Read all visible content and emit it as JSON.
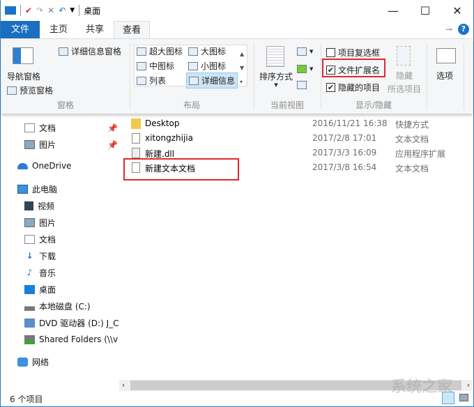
{
  "window": {
    "title": "桌面",
    "minimize": "—",
    "maximize": "☐",
    "close": "✕",
    "help": "?"
  },
  "tabs": [
    {
      "label": "文件"
    },
    {
      "label": "主页"
    },
    {
      "label": "共享"
    },
    {
      "label": "查看"
    }
  ],
  "ribbon": {
    "panes": {
      "nav_pane": "导航窗格",
      "preview_pane": "预览窗格",
      "details_pane": "详细信息窗格",
      "group": "窗格"
    },
    "layout": {
      "items": [
        "超大图标",
        "大图标",
        "中图标",
        "小图标",
        "列表",
        "详细信息"
      ],
      "selected": "详细信息",
      "group": "布局"
    },
    "current_view": {
      "sort_by": "排序方式",
      "group": "当前视图"
    },
    "show_hide": {
      "item_checkboxes": {
        "label": "项目复选框",
        "checked": false
      },
      "file_extensions": {
        "label": "文件扩展名",
        "checked": true
      },
      "hidden_items": {
        "label": "隐藏的项目",
        "checked": true
      },
      "hide_selected_1": "隐藏",
      "hide_selected_2": "所选项目",
      "group": "显示/隐藏"
    },
    "options": "选项"
  },
  "nav": [
    {
      "label": "文档",
      "pinned": true
    },
    {
      "label": "图片",
      "pinned": true
    },
    {
      "label": "OneDrive"
    },
    {
      "label": "此电脑"
    },
    {
      "label": "视频"
    },
    {
      "label": "图片"
    },
    {
      "label": "文档"
    },
    {
      "label": "下载"
    },
    {
      "label": "音乐"
    },
    {
      "label": "桌面"
    },
    {
      "label": "本地磁盘 (C:)"
    },
    {
      "label": "DVD 驱动器 (D:) J_C"
    },
    {
      "label": "Shared Folders (\\\\v"
    },
    {
      "label": "网络"
    }
  ],
  "files": [
    {
      "name": "Desktop",
      "date": "2016/11/21 16:38",
      "type": "快捷方式"
    },
    {
      "name": "xitongzhijia",
      "date": "2017/2/8 17:01",
      "type": "文本文档"
    },
    {
      "name": "新建.dll",
      "date": "2017/3/3 16:09",
      "type": "应用程序扩展"
    },
    {
      "name": "新建文本文档",
      "date": "2017/3/8 16:54",
      "type": "文本文档"
    }
  ],
  "status": {
    "count": "6 个项目"
  },
  "watermark": "系统之家"
}
